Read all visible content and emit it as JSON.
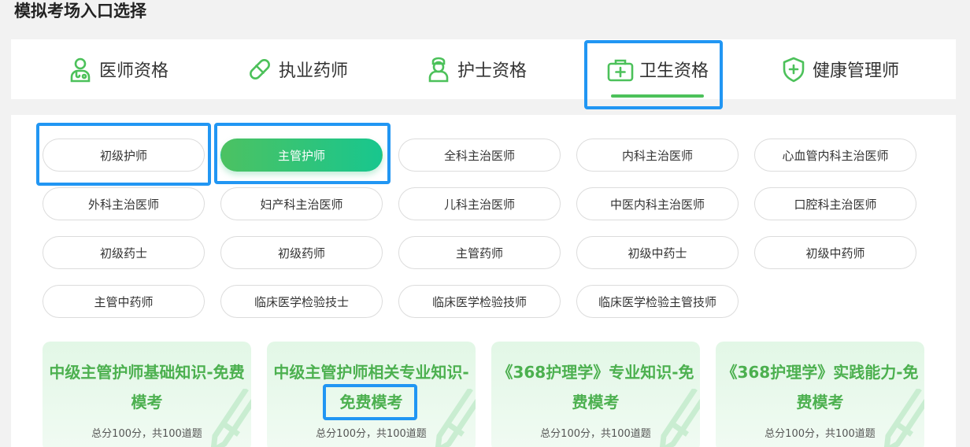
{
  "page": {
    "title": "模拟考场入口选择"
  },
  "categories": [
    {
      "label": "医师资格",
      "icon": "doctor-icon"
    },
    {
      "label": "执业药师",
      "icon": "pill-icon"
    },
    {
      "label": "护士资格",
      "icon": "nurse-icon"
    },
    {
      "label": "卫生资格",
      "icon": "medical-kit-icon",
      "active": true
    },
    {
      "label": "健康管理师",
      "icon": "shield-plus-icon"
    }
  ],
  "subcategories": [
    "初级护师",
    "主管护师",
    "全科主治医师",
    "内科主治医师",
    "心血管内科主治医师",
    "外科主治医师",
    "妇产科主治医师",
    "儿科主治医师",
    "中医内科主治医师",
    "口腔科主治医师",
    "初级药士",
    "初级药师",
    "主管药师",
    "初级中药士",
    "初级中药师",
    "主管中药师",
    "临床医学检验技士",
    "临床医学检验技师",
    "临床医学检验主管技师"
  ],
  "active_subcategory": "主管护师",
  "exams": [
    {
      "title": "中级主管护师基础知识-免费模考",
      "meta": "总分100分，共100道题"
    },
    {
      "title": "中级主管护师相关专业知识-免费模考",
      "meta": "总分100分，共100道题"
    },
    {
      "title": "《368护理学》专业知识-免费模考",
      "meta": "总分100分，共100道题"
    },
    {
      "title": "《368护理学》实践能力-免费模考",
      "meta": "总分100分，共100道题"
    }
  ],
  "colors": {
    "accent_green": "#4cc15a",
    "highlight_blue": "#2196f3",
    "card_title_green": "#4cb04f"
  }
}
